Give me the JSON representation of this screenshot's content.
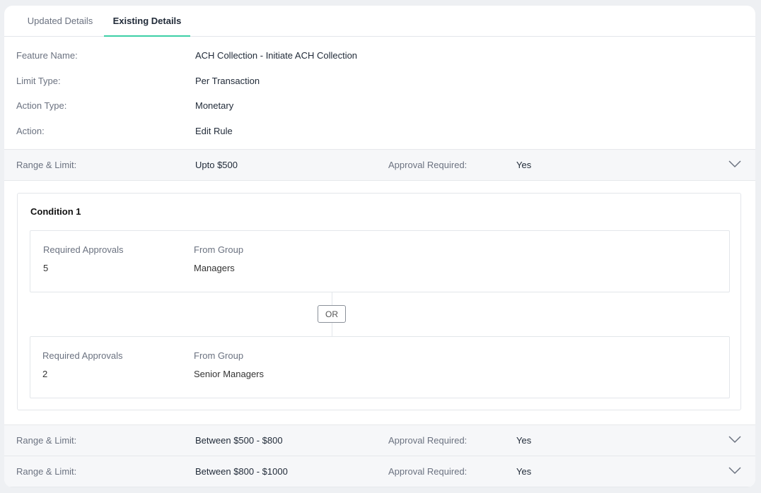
{
  "tabs": [
    {
      "label": "Updated Details",
      "active": false
    },
    {
      "label": "Existing Details",
      "active": true
    }
  ],
  "details": {
    "feature_name_label": "Feature Name:",
    "feature_name_value": "ACH Collection - Initiate ACH Collection",
    "limit_type_label": "Limit Type:",
    "limit_type_value": "Per Transaction",
    "action_type_label": "Action Type:",
    "action_type_value": "Monetary",
    "action_label": "Action:",
    "action_value": "Edit Rule"
  },
  "ranges": [
    {
      "range_label": "Range & Limit:",
      "range_value": "Upto $500",
      "approval_label": "Approval Required:",
      "approval_value": "Yes",
      "expanded": true
    },
    {
      "range_label": "Range & Limit:",
      "range_value": "Between $500 - $800",
      "approval_label": "Approval Required:",
      "approval_value": "Yes",
      "expanded": false
    },
    {
      "range_label": "Range & Limit:",
      "range_value": "Between $800 - $1000",
      "approval_label": "Approval Required:",
      "approval_value": "Yes",
      "expanded": false
    }
  ],
  "condition": {
    "title": "Condition 1",
    "approvals": [
      {
        "required_label": "Required Approvals",
        "required_value": "5",
        "group_label": "From Group",
        "group_value": "Managers"
      },
      {
        "required_label": "Required Approvals",
        "required_value": "2",
        "group_label": "From Group",
        "group_value": "Senior Managers"
      }
    ],
    "separator": "OR"
  },
  "colors": {
    "accent": "#3ccfa6",
    "row_bg": "#f6f7f9",
    "border": "#e3e6ea"
  },
  "icons": {
    "expand": "chevron-down-icon"
  }
}
